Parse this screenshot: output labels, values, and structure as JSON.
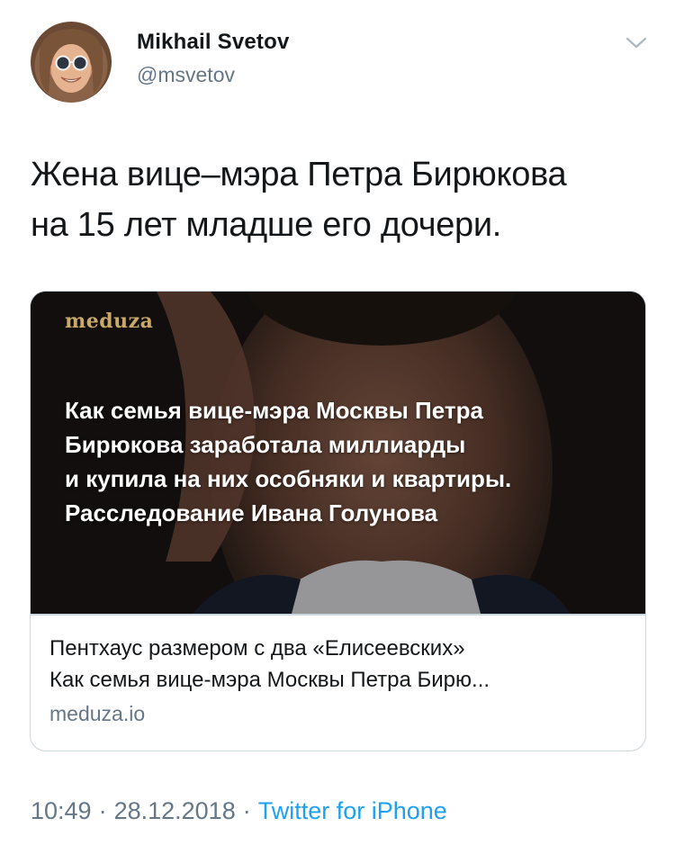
{
  "author": {
    "name": "Mikhail Svetov",
    "handle": "@msvetov"
  },
  "tweet": {
    "text_line1": "Жена вице–мэра Петра Бирюкова",
    "text_line2": "на 15 лет младше его дочери."
  },
  "card": {
    "logo": "meduza",
    "image_headline_line1": "Как семья вице-мэра Москвы Петра",
    "image_headline_line2": "Бирюкова заработала миллиарды",
    "image_headline_line3": "и купила на них особняки и квартиры.",
    "image_headline_line4": "Расследование Ивана Голунова",
    "title": "Пентхаус размером с два «Елисеевских»",
    "description": "Как семья вице-мэра Москвы Петра Бирю...",
    "domain": "meduza.io"
  },
  "footer": {
    "time": "10:49",
    "separator": "·",
    "date": "28.12.2018",
    "source": "Twitter for iPhone"
  },
  "icons": {
    "menu": "chevron-down-icon"
  },
  "colors": {
    "text": "#14171a",
    "secondary": "#657786",
    "link": "#1da1f2",
    "border": "#ccd6dd",
    "logo_gold": "#c9a96a"
  }
}
